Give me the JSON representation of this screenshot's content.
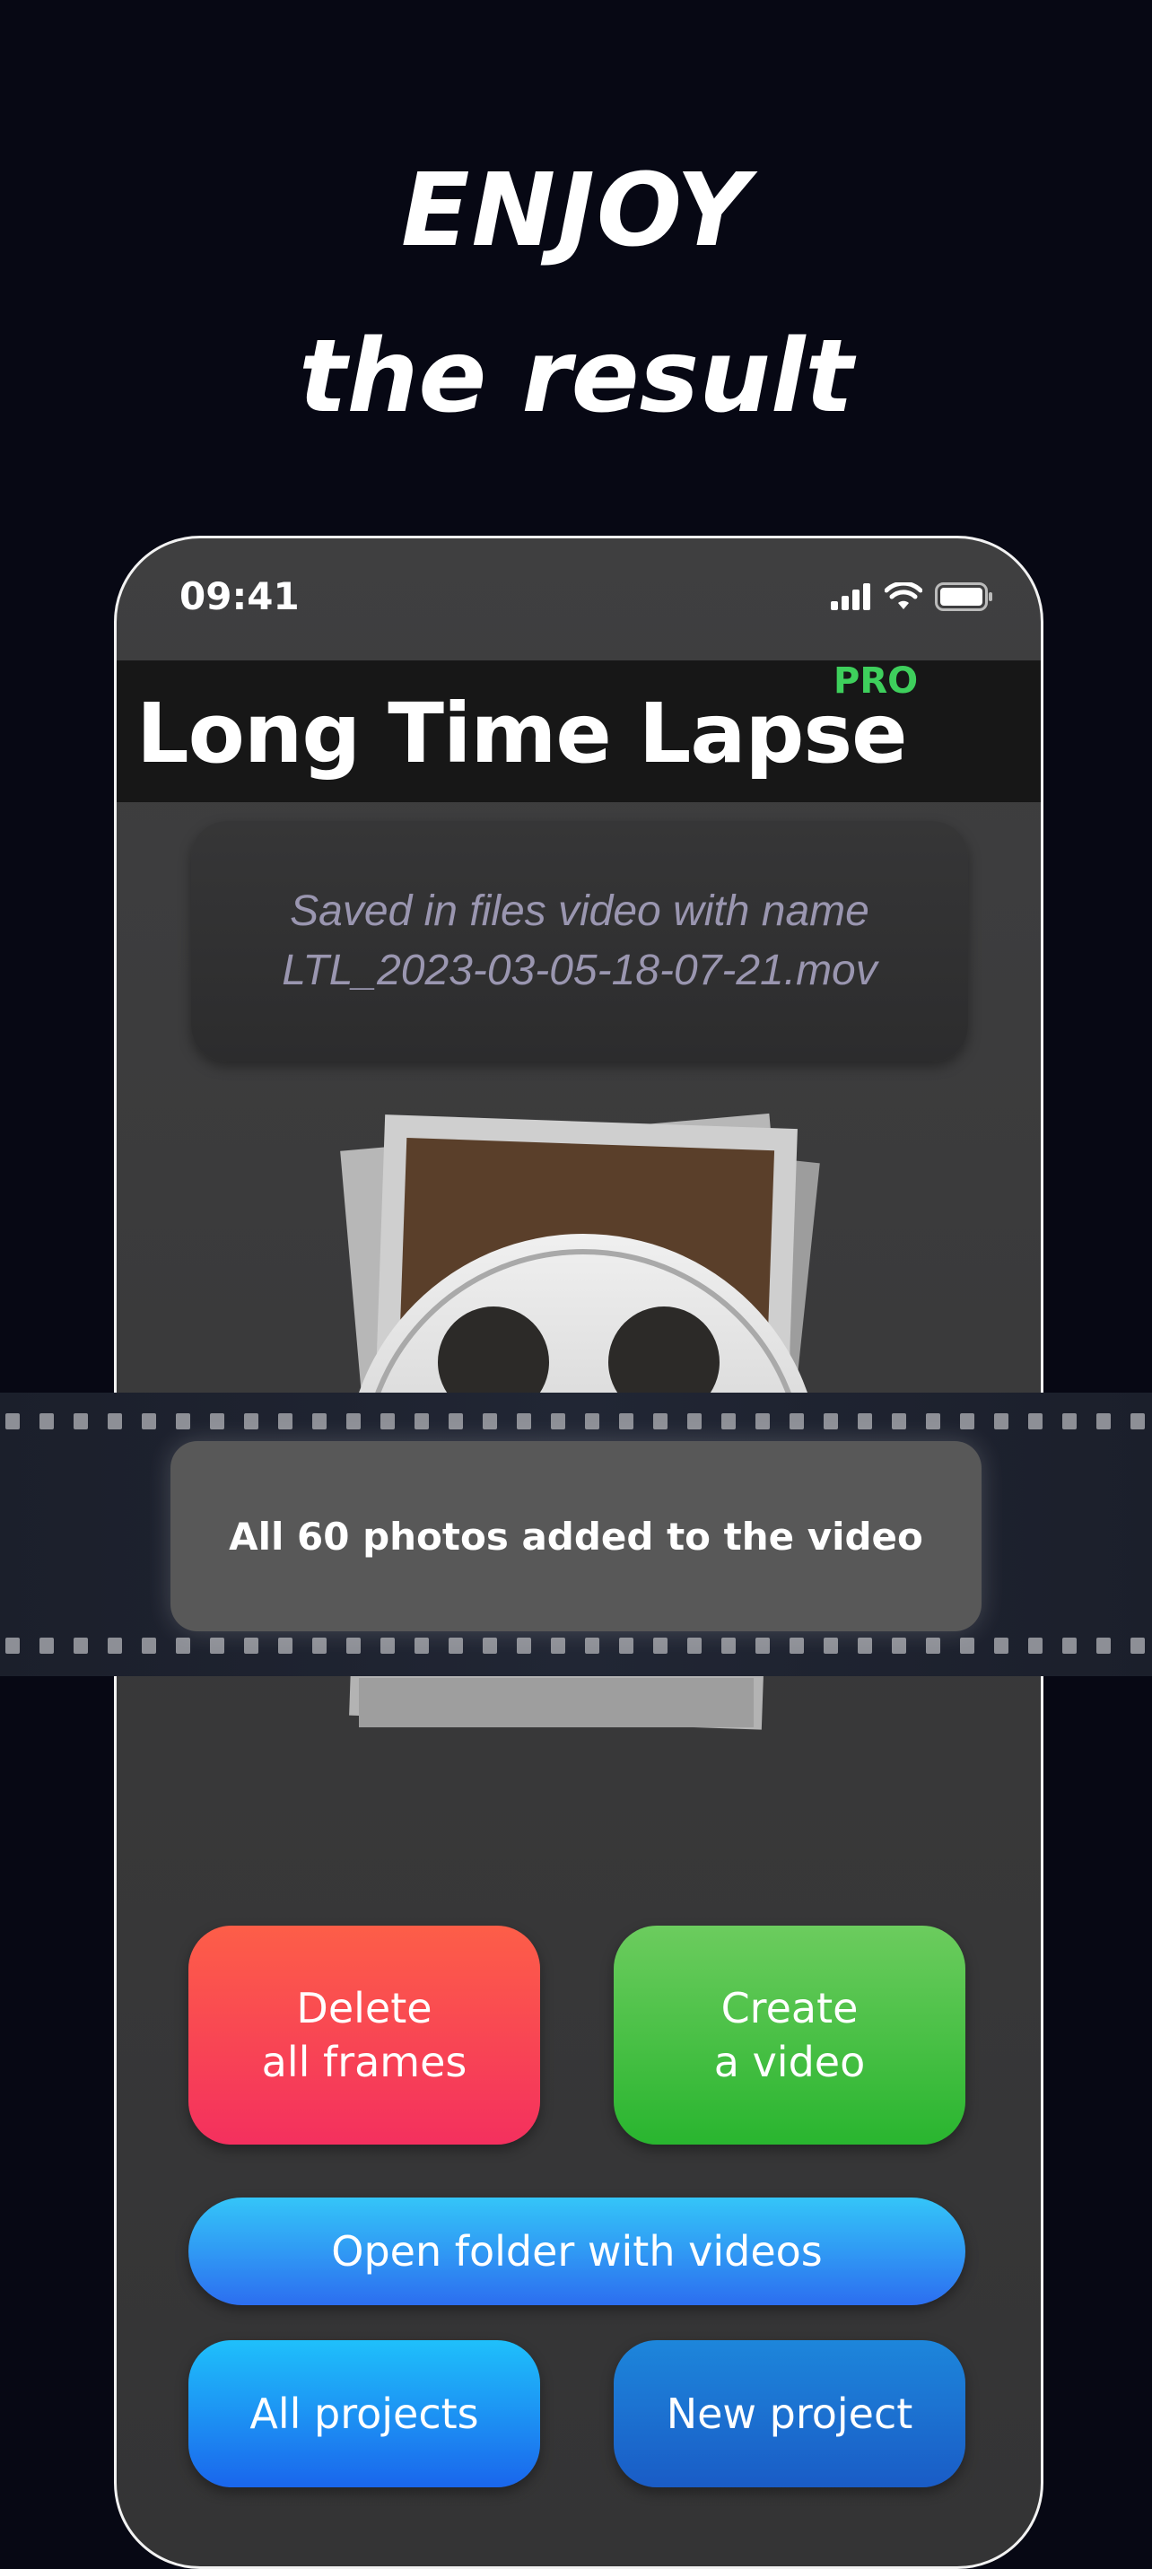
{
  "headline": {
    "line1": "ENJOY",
    "line2": "the result"
  },
  "status_bar": {
    "time": "09:41",
    "icons": [
      "cellular-signal-icon",
      "wifi-icon",
      "battery-icon"
    ]
  },
  "app": {
    "title": "Long Time Lapse",
    "badge": "PRO"
  },
  "saved_message": {
    "line1": "Saved in files video with name",
    "line2": "LTL_2023-03-05-18-07-21.mov"
  },
  "illustration": "film-reel-with-photos-icon",
  "toast": {
    "text": "All 60 photos added to the video"
  },
  "buttons": {
    "delete": {
      "line1": "Delete",
      "line2": "all frames"
    },
    "create": {
      "line1": "Create",
      "line2": "a video"
    },
    "open_folder": "Open folder with videos",
    "all_projects": "All projects",
    "new_project": "New project"
  },
  "colors": {
    "background": "#070814",
    "pro_badge": "#3ecf5c",
    "delete_button": "#f4305e",
    "create_button": "#29b52f",
    "folder_button": "#2c6ef0"
  }
}
